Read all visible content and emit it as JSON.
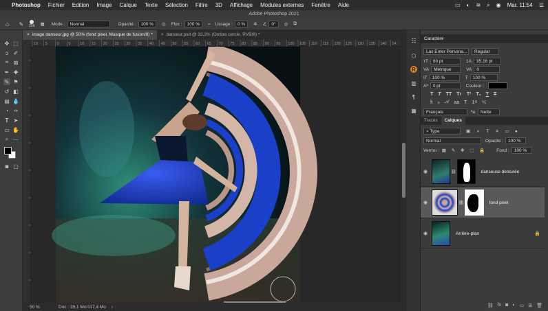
{
  "menubar": {
    "app_name": "Photoshop",
    "items": [
      "Fichier",
      "Edition",
      "Image",
      "Calque",
      "Texte",
      "Sélection",
      "Filtre",
      "3D",
      "Affichage",
      "Modules externes",
      "Fenêtre",
      "Aide"
    ],
    "clock": "Mar. 11:54"
  },
  "window_title": "Adobe Photoshop 2021",
  "options_bar": {
    "brush_size": "256",
    "mode_label": "Mode :",
    "mode_value": "Normal",
    "opacity_label": "Opacité :",
    "opacity_value": "100 %",
    "flow_label": "Flux :",
    "flow_value": "100 %",
    "smoothing_label": "Lissage :",
    "smoothing_value": "0 %",
    "angle_value": "0°"
  },
  "tabs": [
    {
      "label": "image danseur.jpg @ 50% (fond pixel, Masque de fusion/8) *"
    },
    {
      "label": "danseur.psd @ 33,3% (Ombre cercle, RVB/8) *"
    }
  ],
  "ruler_labels": [
    "10",
    "5",
    "0",
    "5",
    "10",
    "15",
    "20",
    "25",
    "30",
    "35",
    "40",
    "45",
    "50",
    "55",
    "60",
    "65",
    "70",
    "75",
    "80",
    "85",
    "90",
    "95",
    "100",
    "105",
    "110",
    "115",
    "120",
    "125",
    "130",
    "135",
    "140",
    "14"
  ],
  "status": {
    "zoom": "50 %",
    "doc": "Doc : 35,1 Mo/117,4 Mo"
  },
  "character_panel": {
    "title": "Caractère",
    "font_family": "Las Enter Persona...",
    "font_style": "Regular",
    "font_size": "60 pt",
    "leading": "35,16 pt",
    "kerning": "Métrique",
    "tracking": "0",
    "vscale": "100 %",
    "hscale": "100 %",
    "baseline": "0 pt",
    "color_label": "Couleur :",
    "language": "Français",
    "antialias": "Nette",
    "aa_prefix": "ªa"
  },
  "layers_panel": {
    "tab_paths": "Tracés",
    "tab_layers": "Calques",
    "filter": "Type",
    "blend_mode": "Normal",
    "opacity_label": "Opacité :",
    "opacity_value": "100 %",
    "lock_label": "Verrou :",
    "fill_label": "Fond :",
    "fill_value": "100 %",
    "layers": [
      {
        "name": "danseuse detourée"
      },
      {
        "name": "fond pixel"
      },
      {
        "name": "Arrière-plan"
      }
    ]
  },
  "colors": {
    "accent_blue": "#1a3fc8",
    "panel_bg": "#3b3b3b"
  }
}
